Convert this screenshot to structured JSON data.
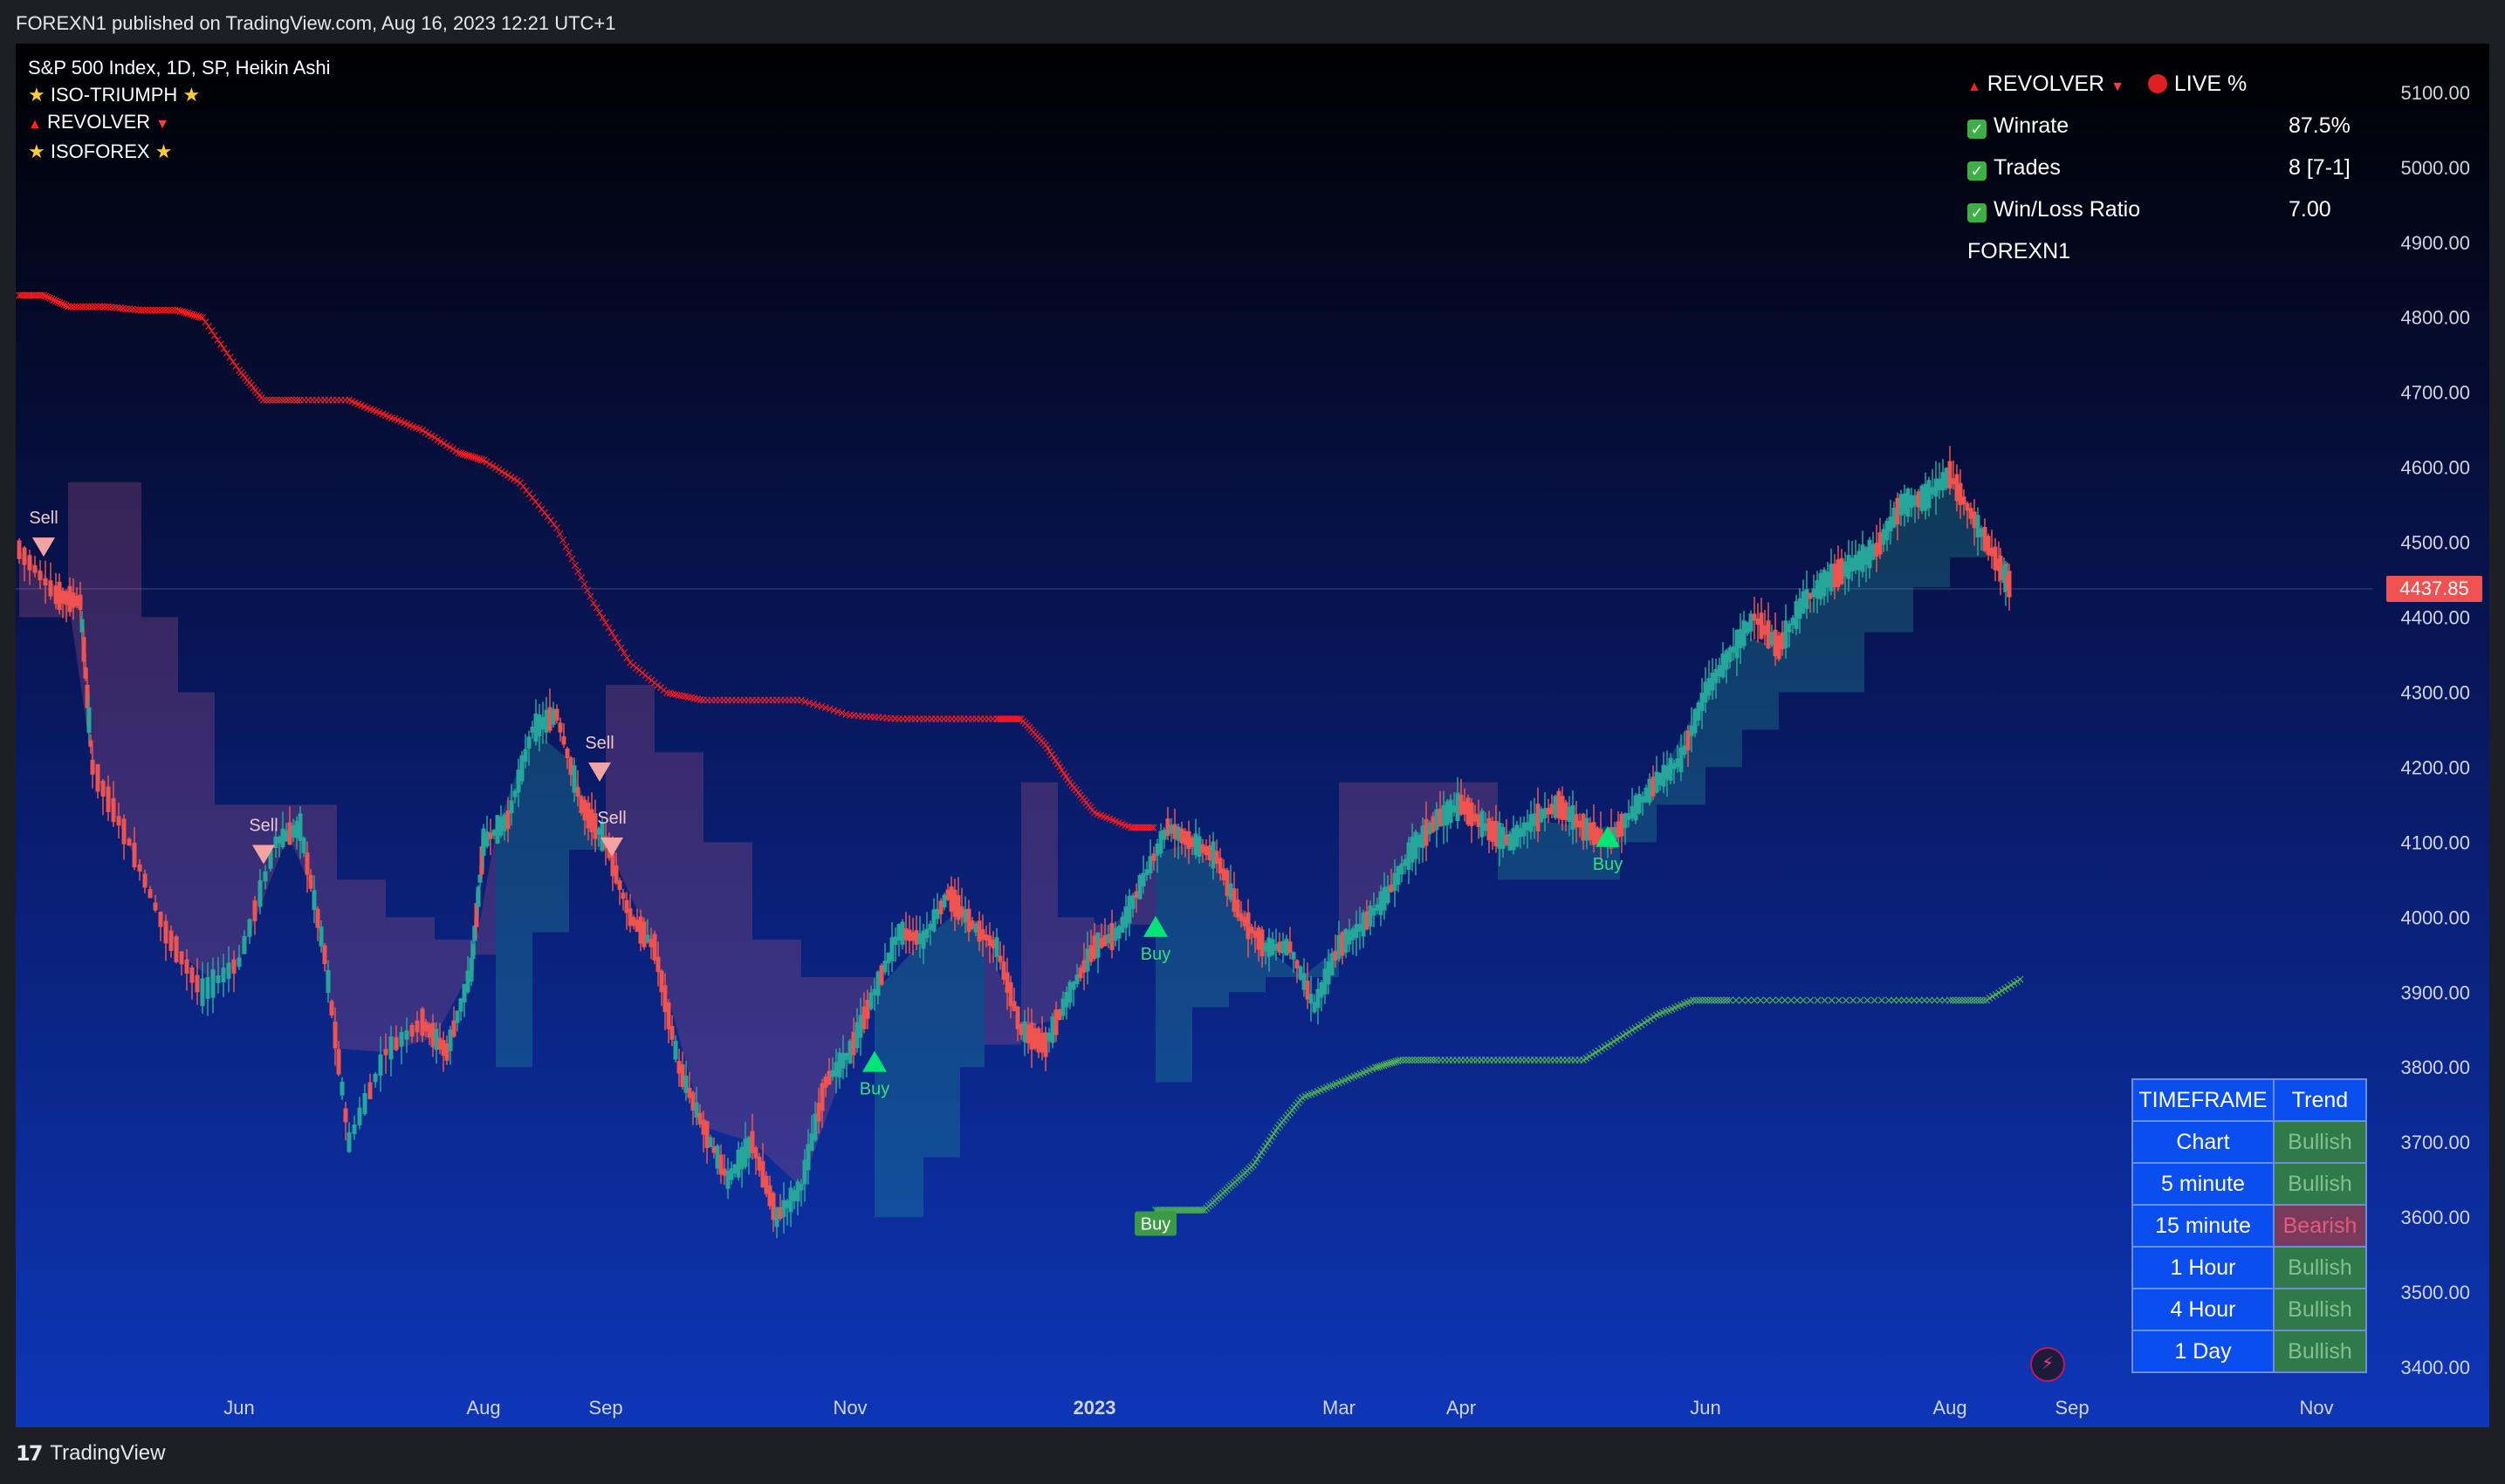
{
  "header": {
    "published": "FOREXN1 published on TradingView.com, Aug 16, 2023 12:21 UTC+1"
  },
  "footer": {
    "brand": "TradingView",
    "logo_mark": "17"
  },
  "legend": {
    "symbol": "S&P 500 Index, 1D, SP, Heikin Ashi",
    "ind1": "ISO-TRIUMPH",
    "ind2": "REVOLVER",
    "ind3": "ISOFOREX"
  },
  "stats": {
    "title": "REVOLVER",
    "live": "LIVE %",
    "winrate_label": "Winrate",
    "winrate": "87.5%",
    "trades_label": "Trades",
    "trades": "8 [7-1]",
    "wl_label": "Win/Loss Ratio",
    "wl": "7.00",
    "author": "FOREXN1"
  },
  "trend_table": {
    "head": [
      "TIMEFRAME",
      "Trend"
    ],
    "rows": [
      {
        "tf": "Chart",
        "trend": "Bullish"
      },
      {
        "tf": "5 minute",
        "trend": "Bullish"
      },
      {
        "tf": "15 minute",
        "trend": "Bearish"
      },
      {
        "tf": "1 Hour",
        "trend": "Bullish"
      },
      {
        "tf": "4 Hour",
        "trend": "Bullish"
      },
      {
        "tf": "1 Day",
        "trend": "Bullish"
      }
    ]
  },
  "colors": {
    "up": "#26a69a",
    "down": "#ef5350",
    "resistance": "#ff1a1a",
    "support": "#4caf50",
    "buy": "#00e676",
    "sell": "#f4a3a3"
  },
  "chart_data": {
    "type": "line",
    "title": "",
    "y_ticks": [
      5100,
      5000,
      4900,
      4800,
      4700,
      4600,
      4500,
      4400,
      4300,
      4200,
      4100,
      4000,
      3900,
      3800,
      3700,
      3600,
      3500,
      3400
    ],
    "ylim": [
      3370,
      5170
    ],
    "x_ticks": [
      {
        "label": "Jun",
        "t": 0.0
      },
      {
        "label": "Aug",
        "t": 2.0
      },
      {
        "label": "Sep",
        "t": 3.0
      },
      {
        "label": "Nov",
        "t": 5.0
      },
      {
        "label": "2023",
        "t": 7.0
      },
      {
        "label": "Mar",
        "t": 9.0
      },
      {
        "label": "Apr",
        "t": 10.0
      },
      {
        "label": "Jun",
        "t": 12.0
      },
      {
        "label": "Aug",
        "t": 14.0
      },
      {
        "label": "Sep",
        "t": 15.0
      },
      {
        "label": "Nov",
        "t": 17.0
      }
    ],
    "last_price": "4437.85",
    "price_path": [
      [
        -1.8,
        4490
      ],
      [
        -1.5,
        4430
      ],
      [
        -1.3,
        4420
      ],
      [
        -1.2,
        4200
      ],
      [
        -0.9,
        4100
      ],
      [
        -0.6,
        3980
      ],
      [
        -0.3,
        3900
      ],
      [
        0.0,
        3940
      ],
      [
        0.3,
        4100
      ],
      [
        0.5,
        4120
      ],
      [
        0.7,
        3950
      ],
      [
        0.9,
        3700
      ],
      [
        1.2,
        3820
      ],
      [
        1.5,
        3860
      ],
      [
        1.7,
        3820
      ],
      [
        1.9,
        3930
      ],
      [
        2.0,
        4100
      ],
      [
        2.2,
        4130
      ],
      [
        2.4,
        4250
      ],
      [
        2.6,
        4270
      ],
      [
        2.8,
        4150
      ],
      [
        3.0,
        4100
      ],
      [
        3.2,
        4000
      ],
      [
        3.4,
        3960
      ],
      [
        3.6,
        3800
      ],
      [
        3.8,
        3720
      ],
      [
        4.0,
        3650
      ],
      [
        4.2,
        3700
      ],
      [
        4.4,
        3600
      ],
      [
        4.6,
        3640
      ],
      [
        4.8,
        3780
      ],
      [
        5.0,
        3820
      ],
      [
        5.2,
        3900
      ],
      [
        5.4,
        3980
      ],
      [
        5.6,
        3970
      ],
      [
        5.8,
        4030
      ],
      [
        6.0,
        3990
      ],
      [
        6.2,
        3960
      ],
      [
        6.4,
        3850
      ],
      [
        6.6,
        3830
      ],
      [
        6.8,
        3900
      ],
      [
        7.0,
        3960
      ],
      [
        7.2,
        3980
      ],
      [
        7.4,
        4050
      ],
      [
        7.6,
        4120
      ],
      [
        7.8,
        4100
      ],
      [
        8.0,
        4080
      ],
      [
        8.2,
        4000
      ],
      [
        8.4,
        3960
      ],
      [
        8.6,
        3960
      ],
      [
        8.8,
        3880
      ],
      [
        9.0,
        3960
      ],
      [
        9.2,
        3990
      ],
      [
        9.4,
        4030
      ],
      [
        9.6,
        4090
      ],
      [
        9.8,
        4130
      ],
      [
        10.0,
        4150
      ],
      [
        10.2,
        4120
      ],
      [
        10.4,
        4100
      ],
      [
        10.6,
        4130
      ],
      [
        10.8,
        4150
      ],
      [
        11.0,
        4120
      ],
      [
        11.2,
        4100
      ],
      [
        11.4,
        4140
      ],
      [
        11.6,
        4180
      ],
      [
        11.8,
        4210
      ],
      [
        12.0,
        4300
      ],
      [
        12.2,
        4350
      ],
      [
        12.4,
        4400
      ],
      [
        12.6,
        4360
      ],
      [
        12.8,
        4420
      ],
      [
        13.0,
        4450
      ],
      [
        13.2,
        4470
      ],
      [
        13.4,
        4490
      ],
      [
        13.6,
        4550
      ],
      [
        13.8,
        4560
      ],
      [
        14.0,
        4590
      ],
      [
        14.2,
        4530
      ],
      [
        14.4,
        4470
      ],
      [
        14.5,
        4440
      ]
    ],
    "cloud_path": [
      [
        -1.8,
        4400,
        "bear"
      ],
      [
        -1.4,
        4580,
        "bear"
      ],
      [
        -1.2,
        4580,
        "bear"
      ],
      [
        -0.8,
        4400,
        "bear"
      ],
      [
        -0.5,
        4300,
        "bear"
      ],
      [
        -0.2,
        4150,
        "bear"
      ],
      [
        0.0,
        4150,
        "bear"
      ],
      [
        0.4,
        4150,
        "bear"
      ],
      [
        0.6,
        4150,
        "bear"
      ],
      [
        0.8,
        4050,
        "bear"
      ],
      [
        1.2,
        4000,
        "bear"
      ],
      [
        1.6,
        3970,
        "bear"
      ],
      [
        1.9,
        3950,
        "bear"
      ],
      [
        2.1,
        3800,
        "bull"
      ],
      [
        2.4,
        3980,
        "bull"
      ],
      [
        2.7,
        4090,
        "bull"
      ],
      [
        2.9,
        4090,
        "bull"
      ],
      [
        3.0,
        4310,
        "bear"
      ],
      [
        3.4,
        4220,
        "bear"
      ],
      [
        3.8,
        4100,
        "bear"
      ],
      [
        4.2,
        3970,
        "bear"
      ],
      [
        4.6,
        3920,
        "bear"
      ],
      [
        5.0,
        3920,
        "bear"
      ],
      [
        5.2,
        3600,
        "bull"
      ],
      [
        5.6,
        3680,
        "bull"
      ],
      [
        5.9,
        3800,
        "bull"
      ],
      [
        6.1,
        3830,
        "bear"
      ],
      [
        6.4,
        4180,
        "bear"
      ],
      [
        6.7,
        4000,
        "bear"
      ],
      [
        7.0,
        3990,
        "bear"
      ],
      [
        7.3,
        3990,
        "bear"
      ],
      [
        7.5,
        3780,
        "bull"
      ],
      [
        7.8,
        3880,
        "bull"
      ],
      [
        8.1,
        3900,
        "bull"
      ],
      [
        8.4,
        3920,
        "bull"
      ],
      [
        8.7,
        3920,
        "bull"
      ],
      [
        9.0,
        4180,
        "bear"
      ],
      [
        9.4,
        4180,
        "bear"
      ],
      [
        9.7,
        4180,
        "bear"
      ],
      [
        10.0,
        4180,
        "bear"
      ],
      [
        10.3,
        4050,
        "bull"
      ],
      [
        10.6,
        4050,
        "bull"
      ],
      [
        11.0,
        4050,
        "bull"
      ],
      [
        11.3,
        4100,
        "bull"
      ],
      [
        11.6,
        4150,
        "bull"
      ],
      [
        12.0,
        4200,
        "bull"
      ],
      [
        12.3,
        4250,
        "bull"
      ],
      [
        12.6,
        4300,
        "bull"
      ],
      [
        13.0,
        4300,
        "bull"
      ],
      [
        13.3,
        4380,
        "bull"
      ],
      [
        13.7,
        4440,
        "bull"
      ],
      [
        14.0,
        4480,
        "bull"
      ],
      [
        14.3,
        4480,
        "bull"
      ]
    ],
    "resistance": [
      [
        -1.8,
        4830
      ],
      [
        -1.6,
        4830
      ],
      [
        -1.4,
        4815
      ],
      [
        -1.1,
        4815
      ],
      [
        -0.8,
        4810
      ],
      [
        -0.5,
        4810
      ],
      [
        -0.3,
        4800
      ],
      [
        0.0,
        4730
      ],
      [
        0.2,
        4690
      ],
      [
        0.5,
        4690
      ],
      [
        0.9,
        4690
      ],
      [
        1.2,
        4670
      ],
      [
        1.5,
        4650
      ],
      [
        1.8,
        4620
      ],
      [
        2.0,
        4610
      ],
      [
        2.3,
        4580
      ],
      [
        2.6,
        4520
      ],
      [
        2.9,
        4420
      ],
      [
        3.2,
        4340
      ],
      [
        3.5,
        4300
      ],
      [
        3.8,
        4290
      ],
      [
        4.2,
        4290
      ],
      [
        4.6,
        4290
      ],
      [
        5.0,
        4270
      ],
      [
        5.4,
        4265
      ],
      [
        5.8,
        4265
      ],
      [
        6.2,
        4265
      ],
      [
        6.4,
        4265
      ],
      [
        6.6,
        4230
      ],
      [
        6.8,
        4180
      ],
      [
        7.0,
        4140
      ],
      [
        7.3,
        4120
      ],
      [
        7.5,
        4120
      ]
    ],
    "support": [
      [
        7.5,
        3610
      ],
      [
        7.7,
        3610
      ],
      [
        7.9,
        3610
      ],
      [
        8.1,
        3640
      ],
      [
        8.3,
        3670
      ],
      [
        8.5,
        3720
      ],
      [
        8.7,
        3760
      ],
      [
        9.0,
        3780
      ],
      [
        9.3,
        3800
      ],
      [
        9.5,
        3810
      ],
      [
        9.8,
        3810
      ],
      [
        10.2,
        3810
      ],
      [
        10.6,
        3810
      ],
      [
        11.0,
        3810
      ],
      [
        11.3,
        3840
      ],
      [
        11.6,
        3870
      ],
      [
        11.9,
        3890
      ],
      [
        12.2,
        3890
      ],
      [
        12.8,
        3890
      ],
      [
        13.5,
        3890
      ],
      [
        14.0,
        3890
      ],
      [
        14.3,
        3890
      ],
      [
        14.6,
        3920
      ]
    ],
    "signals": [
      {
        "type": "Sell",
        "t": -1.6,
        "price": 4490
      },
      {
        "type": "Sell",
        "t": 0.2,
        "price": 4080
      },
      {
        "type": "Sell",
        "t": 2.95,
        "price": 4190
      },
      {
        "type": "Sell",
        "t": 3.05,
        "price": 4090
      },
      {
        "type": "Buy",
        "t": 5.2,
        "price": 3810
      },
      {
        "type": "Buy",
        "t": 7.5,
        "price": 3990
      },
      {
        "type": "Buy",
        "t": 11.2,
        "price": 4110
      }
    ],
    "support_label": "Buy"
  }
}
